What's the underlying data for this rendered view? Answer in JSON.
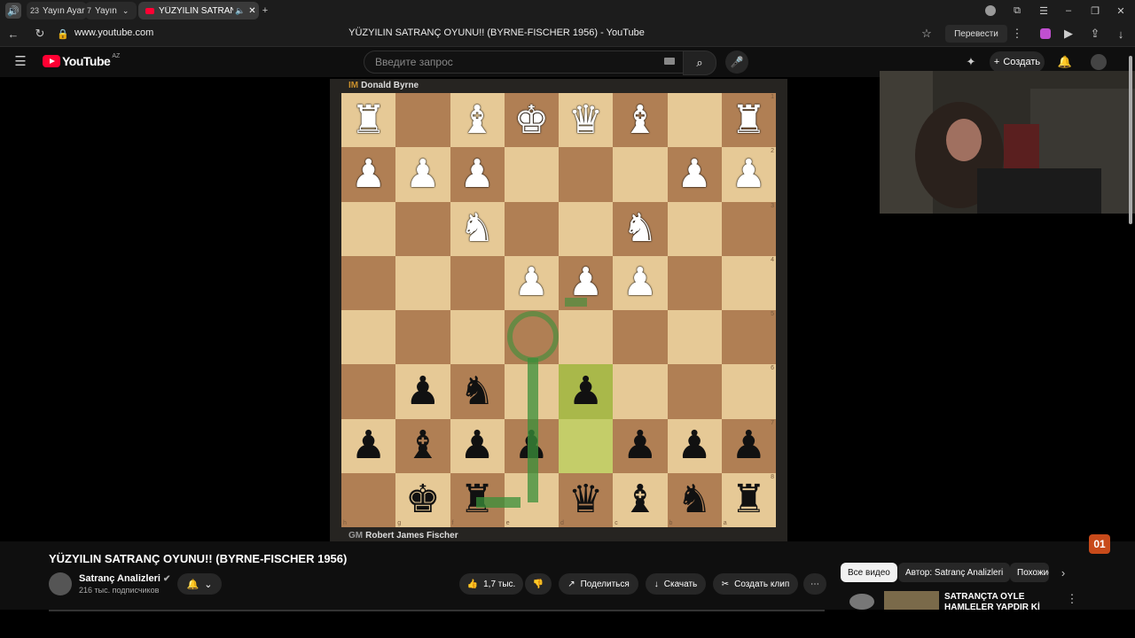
{
  "browser": {
    "tabs": [
      {
        "count": "23",
        "label": "Yayın Ayar"
      },
      {
        "count": "7",
        "label": "Yayın"
      },
      {
        "label": "YÜZYILIN SATRANÇ"
      }
    ],
    "url": "www.youtube.com",
    "page_title": "YÜZYILIN SATRANÇ OYUNU!! (BYRNE-FISCHER 1956) - YouTube",
    "translate_label": "Перевести"
  },
  "masthead": {
    "logo_text": "YouTube",
    "region": "AZ",
    "search_placeholder": "Введите запрос",
    "create_label": "Создать"
  },
  "video": {
    "top_player_title": "IM",
    "top_player_name": "Donald Byrne",
    "bottom_player_title": "GM",
    "bottom_player_name": "Robert James Fischer",
    "badge": "01",
    "board": [
      [
        "R",
        "",
        "B",
        "K",
        "Q",
        "B",
        "",
        "R"
      ],
      [
        "P",
        "P",
        "P",
        "",
        "",
        "",
        "P",
        "P"
      ],
      [
        "",
        "",
        "N",
        "",
        "",
        "N",
        "",
        ""
      ],
      [
        "",
        "",
        "",
        "P",
        "P",
        "P",
        "",
        ""
      ],
      [
        "",
        "",
        "",
        "",
        "",
        "",
        "",
        ""
      ],
      [
        "",
        "p",
        "n",
        "",
        "p",
        "",
        "",
        ""
      ],
      [
        "p",
        "b",
        "p",
        "p",
        "",
        "p",
        "p",
        "p"
      ],
      [
        "",
        "k",
        "r",
        "",
        "q",
        "b",
        "n",
        "r"
      ]
    ],
    "rank_labels": [
      "1",
      "2",
      "3",
      "4",
      "5",
      "6",
      "7",
      "8"
    ],
    "file_labels": [
      "h",
      "g",
      "f",
      "e",
      "d",
      "c",
      "b",
      "a"
    ]
  },
  "details": {
    "title": "YÜZYILIN SATRANÇ OYUNU!! (BYRNE-FISCHER 1956)",
    "channel": "Satranç Analizleri",
    "subscribers": "216 тыс. подписчиков",
    "likes": "1,7 тыс.",
    "share": "Поделиться",
    "download": "Скачать",
    "clip": "Создать клип"
  },
  "sidebar": {
    "chips": [
      "Все видео",
      "Автор: Satranç Analizleri",
      "Похожие"
    ],
    "rec_title": "SATRANÇTA ÖYLE HAMLELER YAPDIR Kİ DERİNLİĞİ ÇOK"
  }
}
